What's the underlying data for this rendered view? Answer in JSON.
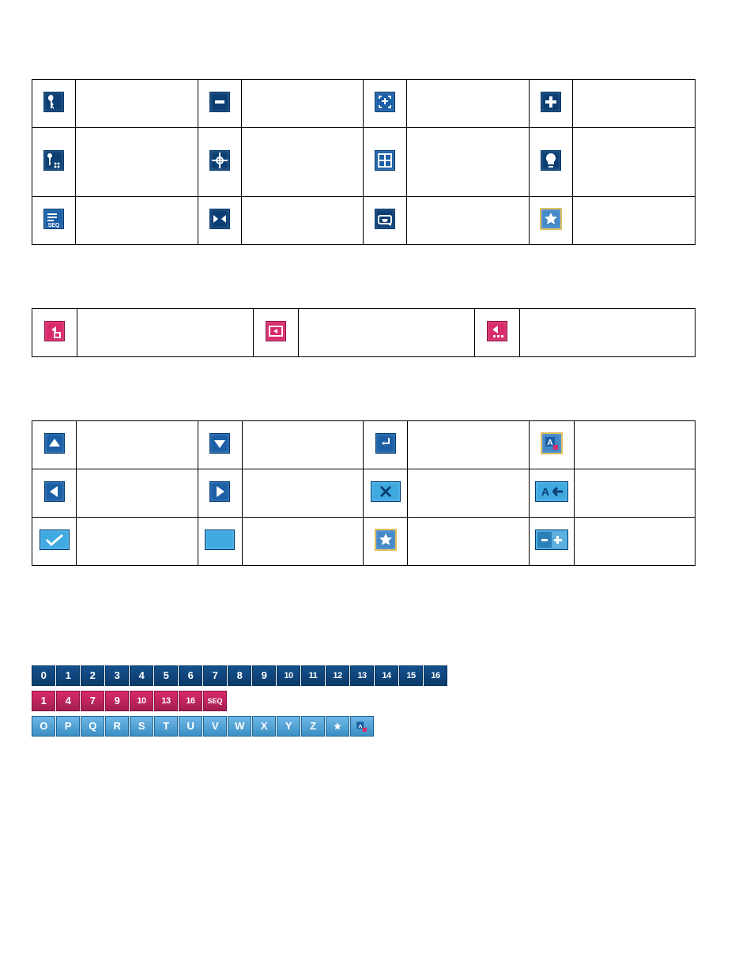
{
  "tables": {
    "t1": {
      "r1": [
        "",
        "",
        "",
        ""
      ],
      "r2": [
        "",
        "",
        "",
        ""
      ],
      "r3": [
        "",
        "",
        "",
        ""
      ]
    },
    "t2": {
      "r1": [
        "",
        "",
        ""
      ]
    },
    "t3": {
      "r1": [
        "",
        "",
        "",
        ""
      ],
      "r2": [
        "",
        "",
        "",
        ""
      ],
      "r3": [
        "",
        "",
        "",
        ""
      ]
    }
  },
  "strips": {
    "a": [
      "0",
      "1",
      "2",
      "3",
      "4",
      "5",
      "6",
      "7",
      "8",
      "9",
      "10",
      "11",
      "12",
      "13",
      "14",
      "15",
      "16"
    ],
    "b": [
      "1",
      "4",
      "7",
      "9",
      "10",
      "13",
      "16",
      "SEQ"
    ],
    "c": [
      "O",
      "P",
      "Q",
      "R",
      "S",
      "T",
      "U",
      "V",
      "W",
      "X",
      "Y",
      "Z",
      "*",
      "A"
    ]
  },
  "icons": {
    "key": "key",
    "keydots": "key-dots",
    "seq": "seq",
    "minus": "minus",
    "target": "target",
    "shuffle": "shuffle",
    "plusminus": "plus-minus",
    "boxplus": "box-plus",
    "tray": "tray",
    "plus": "plus",
    "bulb": "bulb",
    "starframe": "star-frame",
    "backbox": "back-box",
    "backarrow": "back-arrow",
    "backdots": "back-dots",
    "up": "up",
    "down": "down",
    "enter": "enter",
    "a_small": "a-box",
    "left": "left",
    "right": "right",
    "x": "x",
    "aback": "a-back",
    "check": "check",
    "blank": "blank",
    "star2": "star-frame2",
    "pm": "plus-minus-toggle"
  }
}
